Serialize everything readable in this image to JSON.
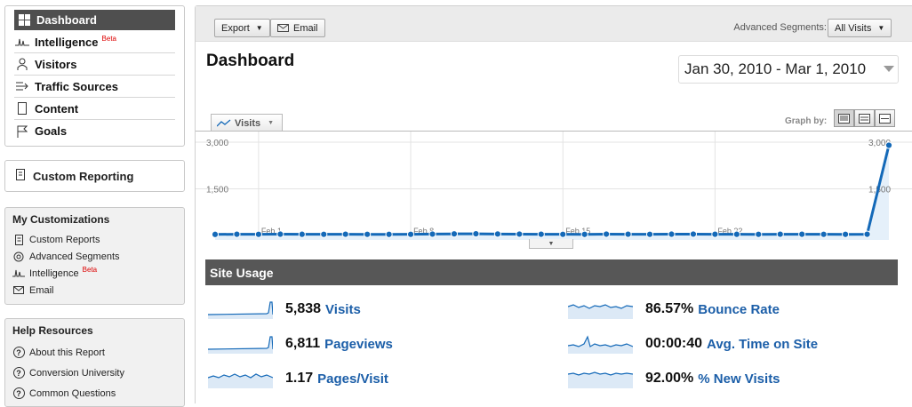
{
  "sidebar": {
    "nav": [
      {
        "label": "Dashboard",
        "icon": "dashboard-icon"
      },
      {
        "label": "Intelligence",
        "icon": "intelligence-icon",
        "badge": "Beta"
      },
      {
        "label": "Visitors",
        "icon": "person-icon"
      },
      {
        "label": "Traffic Sources",
        "icon": "traffic-sources-icon"
      },
      {
        "label": "Content",
        "icon": "content-icon"
      },
      {
        "label": "Goals",
        "icon": "flag-icon"
      }
    ],
    "custom_reporting": "Custom Reporting",
    "my_customizations": {
      "title": "My Customizations",
      "items": [
        {
          "label": "Custom Reports",
          "icon": "report-icon"
        },
        {
          "label": "Advanced Segments",
          "icon": "segments-icon"
        },
        {
          "label": "Intelligence",
          "icon": "intelligence-icon",
          "badge": "Beta"
        },
        {
          "label": "Email",
          "icon": "envelope-icon"
        }
      ]
    },
    "help": {
      "title": "Help Resources",
      "items": [
        {
          "label": "About this Report",
          "icon": "question-icon"
        },
        {
          "label": "Conversion University",
          "icon": "question-icon"
        },
        {
          "label": "Common Questions",
          "icon": "question-icon"
        }
      ]
    }
  },
  "toolbar": {
    "export_label": "Export",
    "email_label": "Email",
    "segments_label": "Advanced Segments:",
    "segments_value": "All Visits"
  },
  "page_title": "Dashboard",
  "date_range": "Jan 30, 2010 - Mar 1, 2010",
  "graph": {
    "metric_label": "Visits",
    "graph_by_label": "Graph by:"
  },
  "chart_data": {
    "type": "line",
    "series": [
      {
        "values": [
          35,
          40,
          38,
          42,
          39,
          38,
          41,
          37,
          36,
          38,
          45,
          52,
          55,
          48,
          44,
          40,
          38,
          36,
          43,
          41,
          38,
          42,
          44,
          40,
          39,
          37,
          41,
          40,
          38,
          36,
          40,
          2900
        ]
      }
    ],
    "ylim": [
      0,
      3000
    ],
    "ytick_labels": [
      "3,000",
      "1,500"
    ],
    "xtick_labels": [
      "Feb 1",
      "Feb 8",
      "Feb 15",
      "Feb 22"
    ],
    "grid": true,
    "color": "#1469b8"
  },
  "site_usage": {
    "title": "Site Usage",
    "metrics": [
      {
        "value": "5,838",
        "label": "Visits"
      },
      {
        "value": "6,811",
        "label": "Pageviews"
      },
      {
        "value": "1.17",
        "label": "Pages/Visit"
      },
      {
        "value": "86.57%",
        "label": "Bounce Rate"
      },
      {
        "value": "00:00:40",
        "label": "Avg. Time on Site"
      },
      {
        "value": "92.00%",
        "label": "% New Visits"
      }
    ]
  }
}
